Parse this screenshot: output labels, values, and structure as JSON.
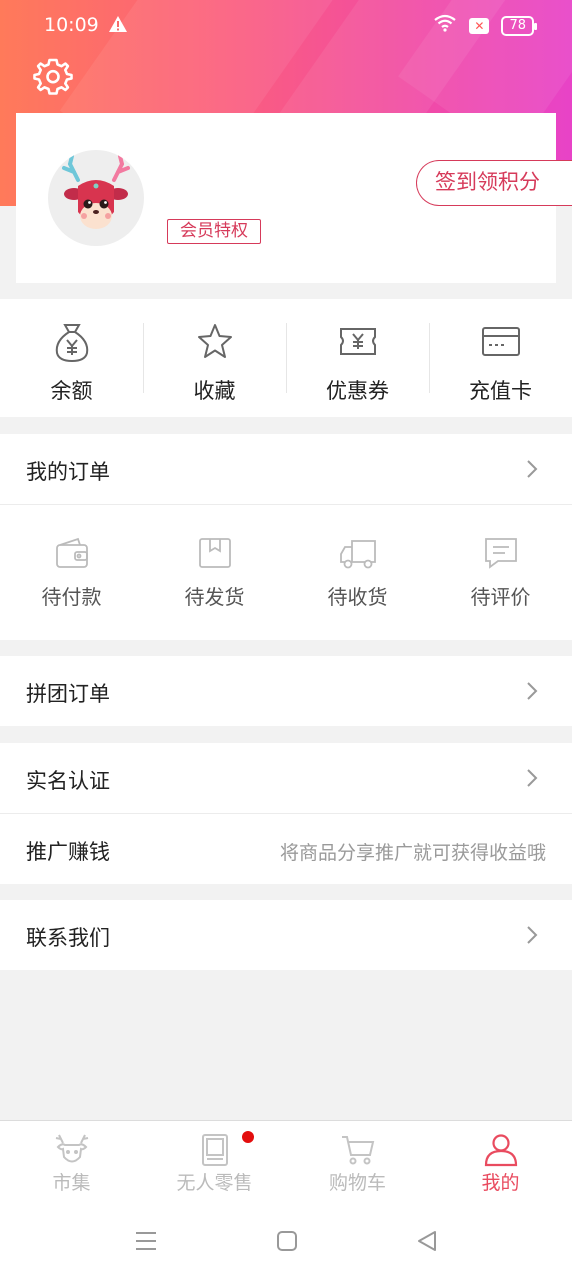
{
  "status_bar": {
    "time": "10:09",
    "battery": "78"
  },
  "colors": {
    "accent": "#d63a5a",
    "tab_active": "#e94b5f",
    "gradient_start": "#ff7a5a",
    "gradient_end": "#e843c7"
  },
  "profile": {
    "vip_label": "会员特权",
    "signin_label": "签到领积分"
  },
  "quick_actions": [
    {
      "label": "余额",
      "icon": "money-bag-icon"
    },
    {
      "label": "收藏",
      "icon": "star-icon"
    },
    {
      "label": "优惠券",
      "icon": "coupon-icon"
    },
    {
      "label": "充值卡",
      "icon": "card-icon"
    }
  ],
  "orders": {
    "title": "我的订单",
    "statuses": [
      {
        "label": "待付款",
        "icon": "wallet-icon"
      },
      {
        "label": "待发货",
        "icon": "box-icon"
      },
      {
        "label": "待收货",
        "icon": "truck-icon"
      },
      {
        "label": "待评价",
        "icon": "comment-icon"
      }
    ]
  },
  "menu": {
    "group_orders": "拼团订单",
    "real_name": "实名认证",
    "promote": "推广赚钱",
    "promote_hint": "将商品分享推广就可获得收益哦",
    "contact": "联系我们"
  },
  "tabbar": [
    {
      "label": "市集",
      "icon": "deer-icon"
    },
    {
      "label": "无人零售",
      "icon": "vending-icon"
    },
    {
      "label": "购物车",
      "icon": "cart-icon"
    },
    {
      "label": "我的",
      "icon": "user-icon",
      "active": true
    }
  ]
}
